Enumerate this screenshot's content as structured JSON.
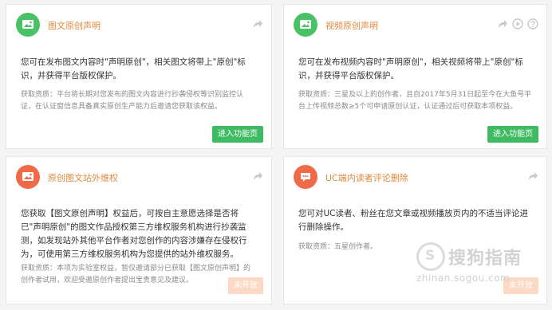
{
  "cards": [
    {
      "title": "图文原创声明",
      "desc": "您可在发布图文内容时\"声明原创\"，相关图文将带上\"原创\"标识，并获得平台版权保护。",
      "info": "获取资质：平台将长期对您发布的图文内容进行抄袭侵权等识别监控认证，在认证窗信息具备真实原创生产能力后邀请您获取该权益。",
      "button": "进入功能页",
      "button_state": "active",
      "badge_color": "#49c165"
    },
    {
      "title": "视频原创声明",
      "desc": "您可在发布视频内容时\"声明原创\"，相关视频将带上\"原创\"标识，并获得平台版权保护。",
      "info": "获取资质：三星及以上的创作者，且自2017年5月31日起至今在大鱼号平台上传视频总数≥5个可申请原创认证，认证通过后可获取本项权益。",
      "button": "进入功能页",
      "button_state": "active",
      "badge_color": "#49c165"
    },
    {
      "title": "原创图文站外维权",
      "desc": "您获取【图文原创声明】权益后，可按自主意愿选择是否将已\"声明原创\"的图文作品授权第三方维权服务机构进行抄袭监测，如发现站外其他平台作者对您创作的内容涉嫌存在侵权行为，可使用第三方维权服务机构为您提供的站外维权服务。",
      "info": "获取资质：本项为实验室权益，暂仅邀请部分已获取【图文原创声明】的创作者试用，欢迎受邀原创作者提出宝贵意见及建议。",
      "button": "未开放",
      "button_state": "disabled",
      "badge_color": "#f06a4a"
    },
    {
      "title": "UC端内读者评论删除",
      "desc": "您可对UC读者、粉丝在您文章或视频播放页内的不适当评论进行删除操作。",
      "info": "获取资质：五星创作者。",
      "button": "未开放",
      "button_state": "disabled",
      "badge_color": "#f06a4a"
    }
  ],
  "watermark": {
    "logo_letter": "S",
    "text": "搜狗指南",
    "url": "zhinan.sogou.com"
  },
  "icons": {
    "share": "share-arrow-icon",
    "play": "play-icon",
    "help": "help-icon"
  }
}
